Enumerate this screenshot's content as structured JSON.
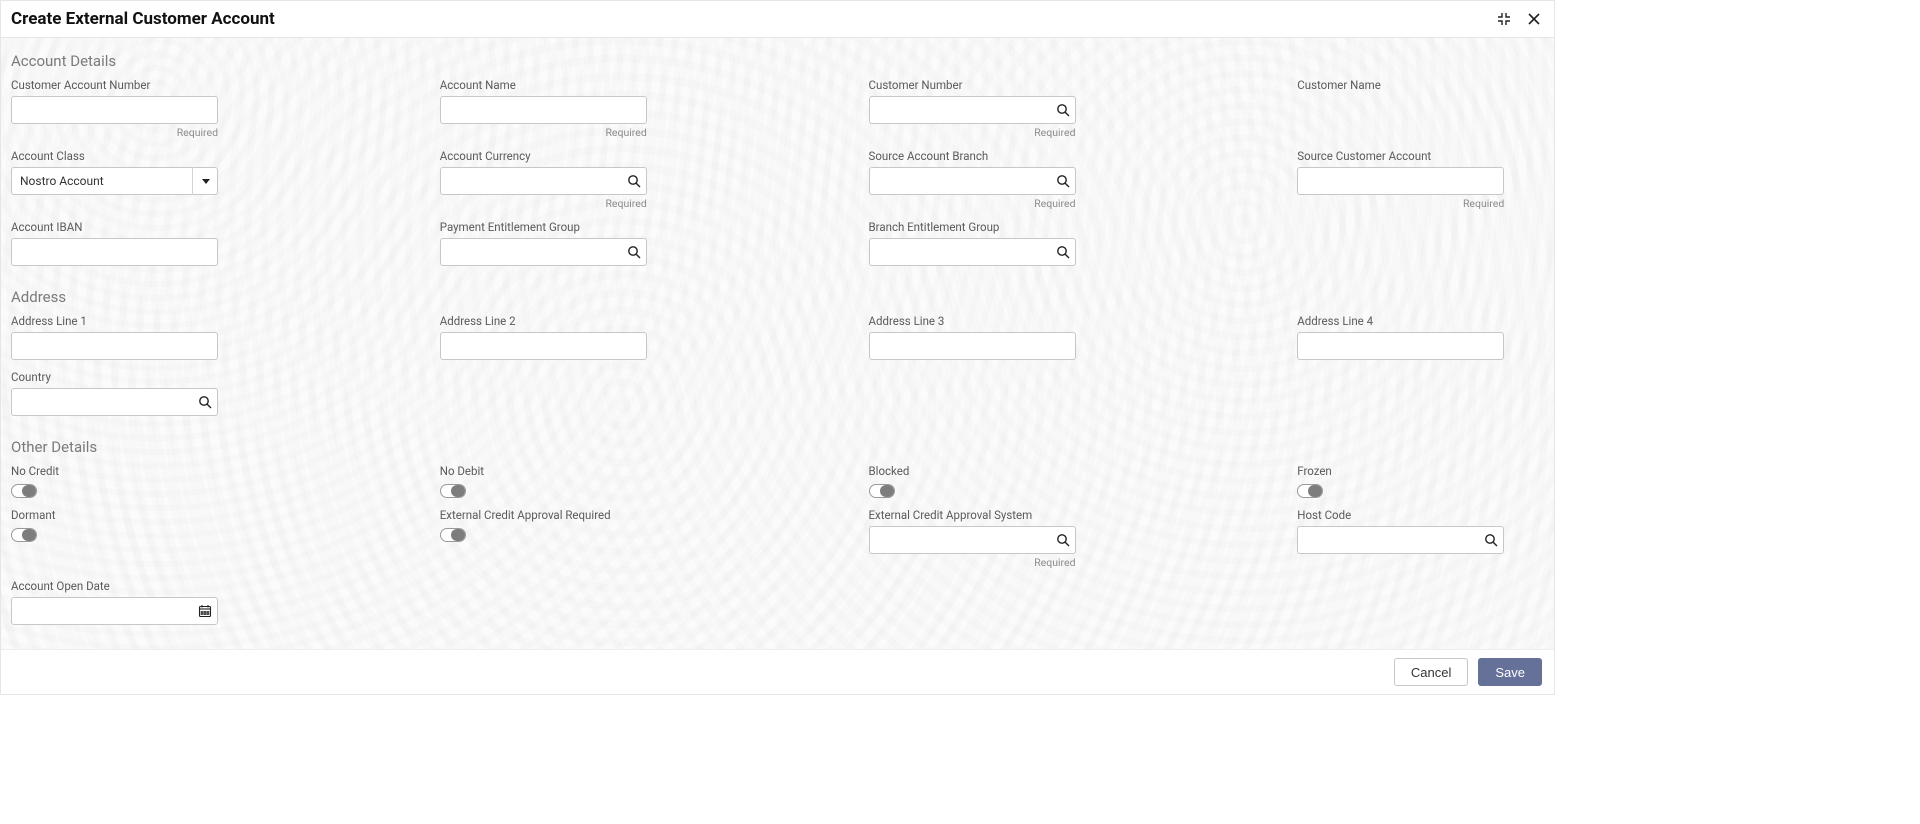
{
  "dialog": {
    "title": "Create External Customer Account"
  },
  "hints": {
    "required": "Required"
  },
  "sections": {
    "account": {
      "title": "Account Details"
    },
    "address": {
      "title": "Address"
    },
    "other": {
      "title": "Other Details"
    }
  },
  "fields": {
    "customer_account_number": {
      "label": "Customer Account Number",
      "value": ""
    },
    "account_name": {
      "label": "Account Name",
      "value": ""
    },
    "customer_number": {
      "label": "Customer Number",
      "value": ""
    },
    "customer_name": {
      "label": "Customer Name",
      "value": ""
    },
    "account_class": {
      "label": "Account Class",
      "value": "Nostro Account"
    },
    "account_currency": {
      "label": "Account Currency",
      "value": ""
    },
    "source_account_branch": {
      "label": "Source Account Branch",
      "value": ""
    },
    "source_customer_account": {
      "label": "Source Customer Account",
      "value": ""
    },
    "account_iban": {
      "label": "Account IBAN",
      "value": ""
    },
    "payment_entitlement_group": {
      "label": "Payment Entitlement Group",
      "value": ""
    },
    "branch_entitlement_group": {
      "label": "Branch Entitlement Group",
      "value": ""
    },
    "address_line_1": {
      "label": "Address Line 1",
      "value": ""
    },
    "address_line_2": {
      "label": "Address Line 2",
      "value": ""
    },
    "address_line_3": {
      "label": "Address Line 3",
      "value": ""
    },
    "address_line_4": {
      "label": "Address Line 4",
      "value": ""
    },
    "country": {
      "label": "Country",
      "value": ""
    },
    "no_credit": {
      "label": "No Credit",
      "value": false
    },
    "no_debit": {
      "label": "No Debit",
      "value": false
    },
    "blocked": {
      "label": "Blocked",
      "value": false
    },
    "frozen": {
      "label": "Frozen",
      "value": false
    },
    "dormant": {
      "label": "Dormant",
      "value": false
    },
    "external_credit_approval_required": {
      "label": "External Credit Approval Required",
      "value": false
    },
    "external_credit_approval_system": {
      "label": "External Credit Approval System",
      "value": ""
    },
    "host_code": {
      "label": "Host Code",
      "value": ""
    },
    "account_open_date": {
      "label": "Account Open Date",
      "value": ""
    }
  },
  "buttons": {
    "cancel": "Cancel",
    "save": "Save"
  }
}
